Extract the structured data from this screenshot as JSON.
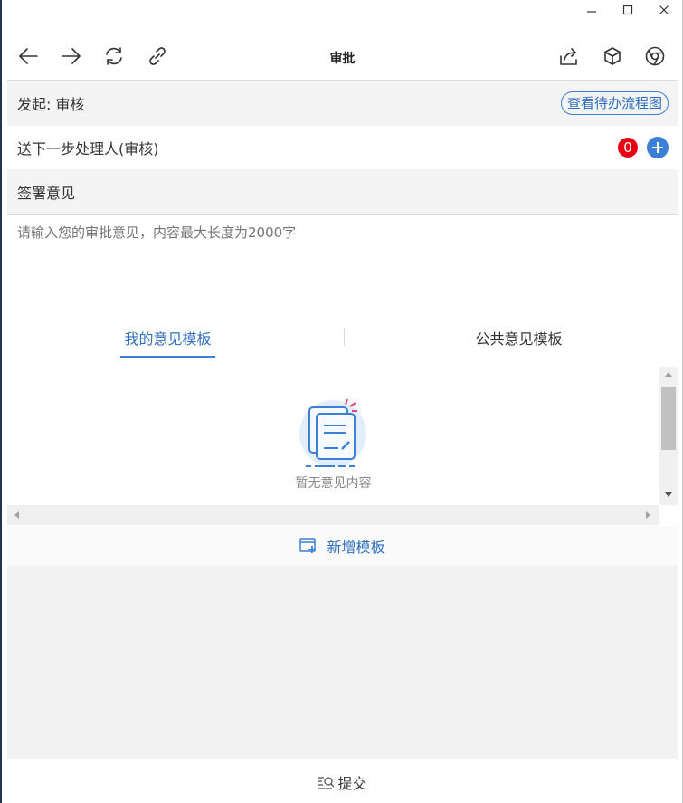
{
  "window": {
    "controls": [
      "minimize-icon",
      "maximize-icon",
      "close-icon"
    ]
  },
  "toolbar": {
    "title": "审批",
    "left_icons": [
      "back-arrow-icon",
      "forward-arrow-icon",
      "refresh-icon",
      "link-icon"
    ],
    "right_icons": [
      "share-icon",
      "cube-icon",
      "chrome-icon"
    ]
  },
  "form": {
    "initiator": "发起: 审核",
    "flow_chart_link": "查看待办流程图",
    "next_handler_label": "送下一步处理人(审核)",
    "handler_count": "0",
    "signature_label": "签署意见",
    "opinion_placeholder": "请输入您的审批意见，内容最大长度为2000字"
  },
  "templates": {
    "tabs": [
      {
        "label": "我的意见模板",
        "active": true
      },
      {
        "label": "公共意见模板",
        "active": false
      }
    ],
    "empty_text": "暂无意见内容",
    "add_label": "新增模板"
  },
  "footer": {
    "submit_label": "提交"
  },
  "colors": {
    "accent": "#3b80d6",
    "badge": "#e60012",
    "grey_bg": "#f4f4f4"
  }
}
